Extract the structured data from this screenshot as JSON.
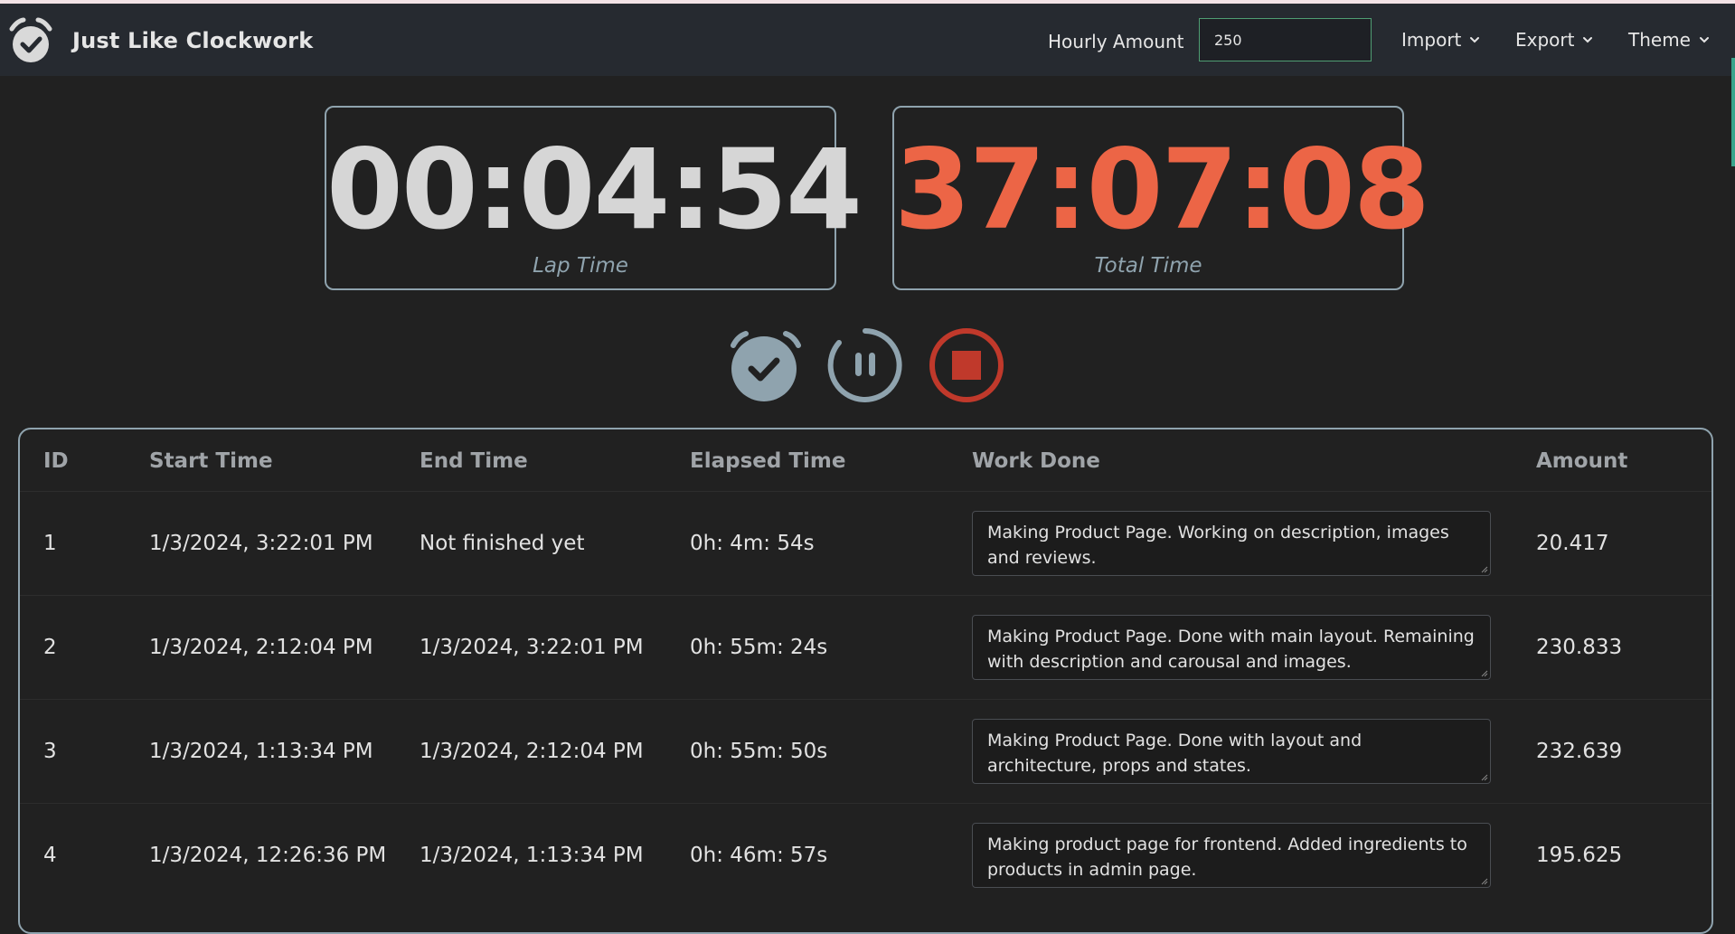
{
  "app": {
    "title": "Just Like Clockwork"
  },
  "header": {
    "hourly_label": "Hourly Amount",
    "hourly_value": "250",
    "menus": [
      {
        "label": "Import"
      },
      {
        "label": "Export"
      },
      {
        "label": "Theme"
      }
    ]
  },
  "timers": {
    "lap": {
      "value": "00:04:54",
      "caption": "Lap Time",
      "color": "#d6d6d6"
    },
    "total": {
      "value": "37:07:08",
      "caption": "Total Time",
      "color": "#ec6546"
    }
  },
  "controls": {
    "lap_icon": "alarm-check-icon",
    "pause_icon": "pause-circle-icon",
    "stop_icon": "stop-circle-icon"
  },
  "table": {
    "columns": [
      "ID",
      "Start Time",
      "End Time",
      "Elapsed Time",
      "Work Done",
      "Amount"
    ],
    "rows": [
      {
        "id": "1",
        "start": "1/3/2024, 3:22:01 PM",
        "end": "Not finished yet",
        "elapsed": "0h: 4m: 54s",
        "work": "Making Product Page. Working on description, images and reviews.",
        "amount": "20.417"
      },
      {
        "id": "2",
        "start": "1/3/2024, 2:12:04 PM",
        "end": "1/3/2024, 3:22:01 PM",
        "elapsed": "0h: 55m: 24s",
        "work": "Making Product Page. Done with main layout. Remaining with description and carousal and images.",
        "amount": "230.833"
      },
      {
        "id": "3",
        "start": "1/3/2024, 1:13:34 PM",
        "end": "1/3/2024, 2:12:04 PM",
        "elapsed": "0h: 55m: 50s",
        "work": "Making Product Page. Done with layout and architecture, props and states.",
        "amount": "232.639"
      },
      {
        "id": "4",
        "start": "1/3/2024, 12:26:36 PM",
        "end": "1/3/2024, 1:13:34 PM",
        "elapsed": "0h: 46m: 57s",
        "work": "Making product page for frontend. Added ingredients to products in admin page.",
        "amount": "195.625"
      }
    ]
  },
  "colors": {
    "background": "#212121",
    "navbar": "#262a30",
    "border": "#8fa3ae",
    "accent_total": "#ec6546",
    "stop": "#c0392b",
    "input_border": "#4f9d72"
  }
}
